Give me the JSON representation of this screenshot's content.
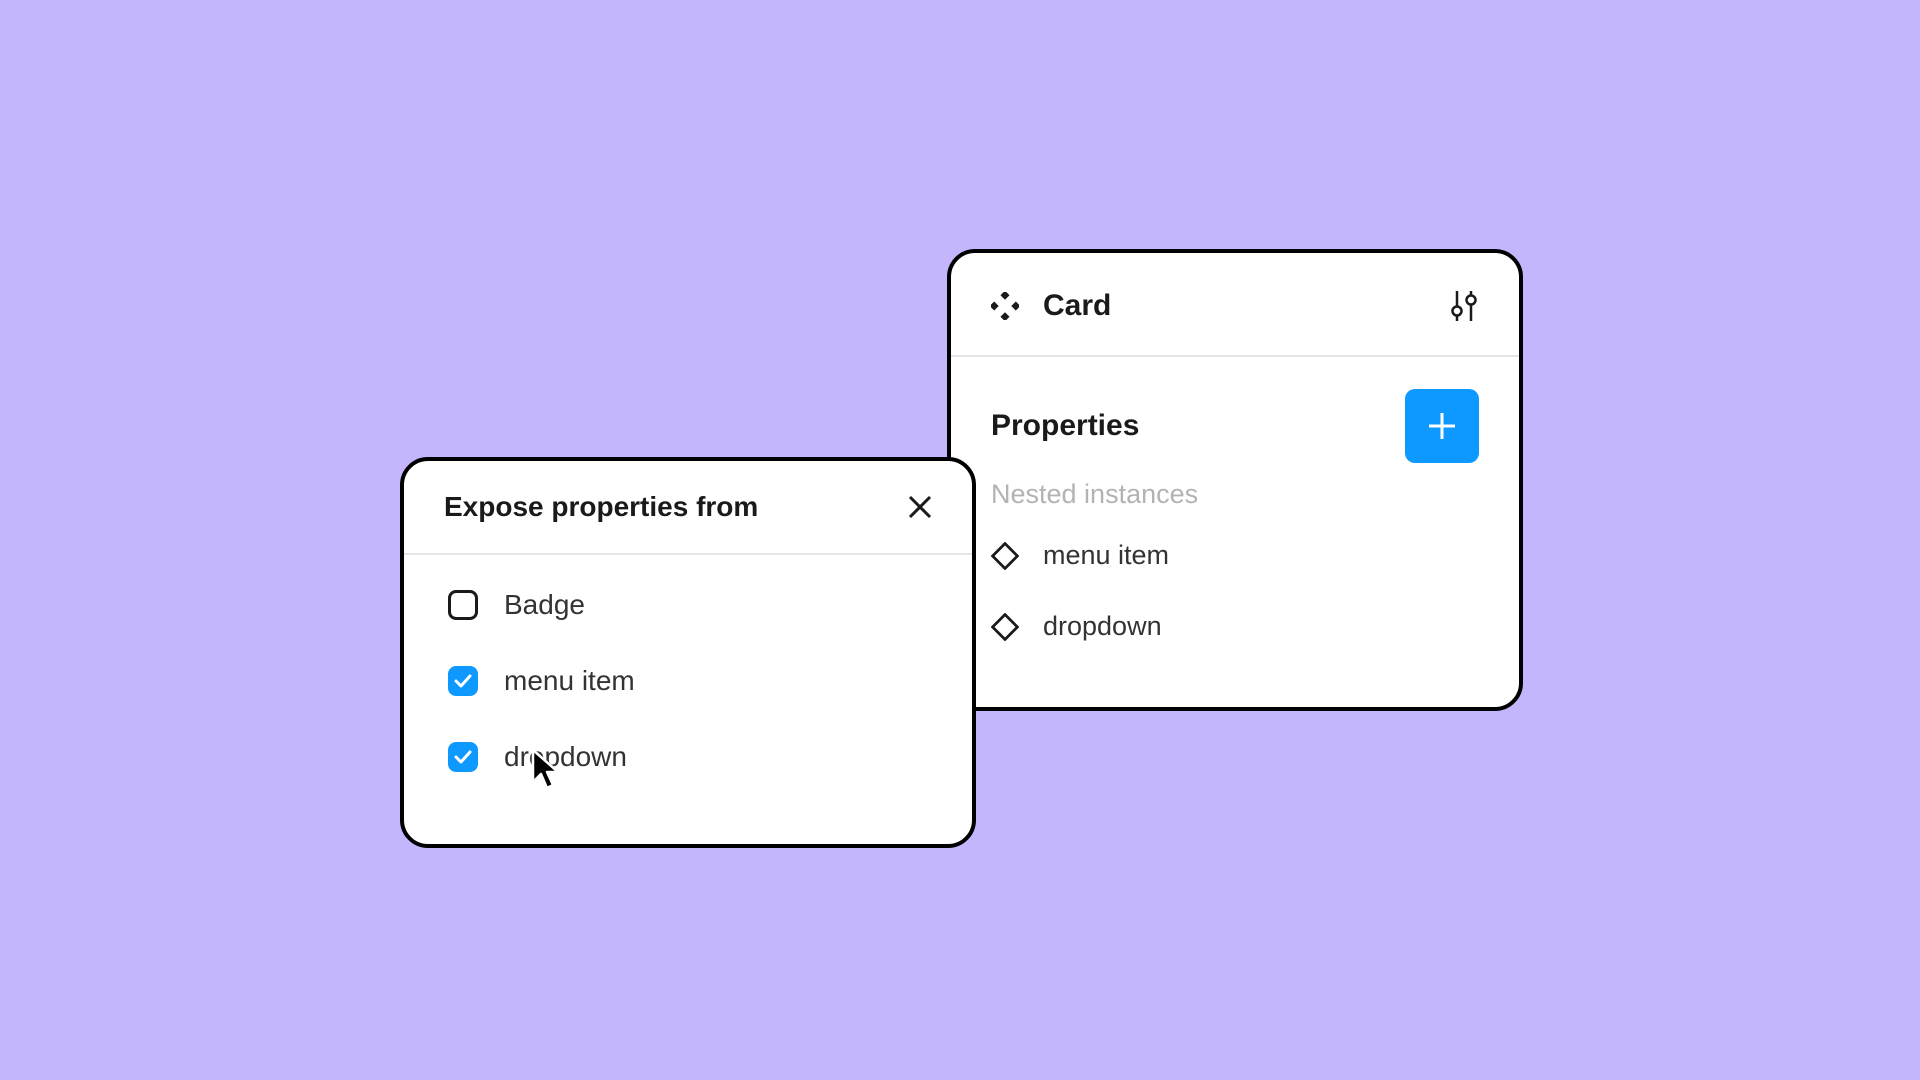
{
  "panel": {
    "title": "Card",
    "properties_label": "Properties",
    "section_label": "Nested instances",
    "instances": [
      {
        "label": "menu item"
      },
      {
        "label": "dropdown"
      }
    ]
  },
  "dialog": {
    "title": "Expose properties from",
    "items": [
      {
        "label": "Badge",
        "checked": false
      },
      {
        "label": "menu item",
        "checked": true
      },
      {
        "label": "dropdown",
        "checked": true
      }
    ]
  },
  "colors": {
    "background": "#c4b5fd",
    "accent": "#0d99ff"
  }
}
